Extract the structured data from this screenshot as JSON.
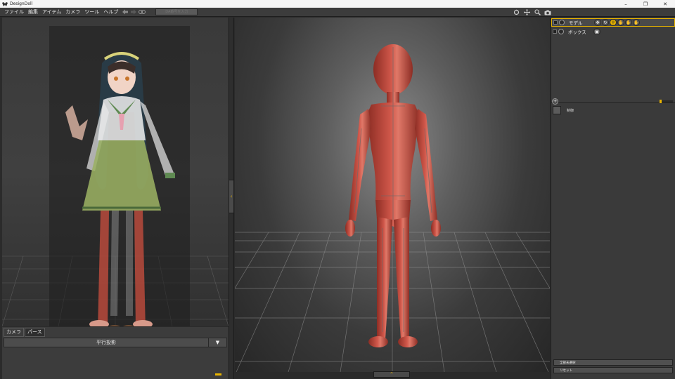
{
  "window": {
    "title": "DesignDoll",
    "minimize": "–",
    "maximize": "❐",
    "close": "✕"
  },
  "menu": {
    "items": [
      "ファイル",
      "編集",
      "アイテム",
      "カメラ",
      "ツール",
      "ヘルプ"
    ],
    "da_input_placeholder": "DA番号を入力"
  },
  "left_panel": {
    "tabs": [
      "カメラ",
      "パース"
    ],
    "active_tab": "パース",
    "projection_value": "平行投影",
    "dropdown_arrow": "▼",
    "collapse_arrow": "‹"
  },
  "viewport": {
    "expand_arrow": "^"
  },
  "scene": {
    "rows": [
      {
        "label": "モデル",
        "selected": true,
        "icons": [
          "move-icon",
          "rotate-icon",
          "zoom-icon",
          "hand-pose-icon",
          "hand-icon",
          "hand-alt-icon"
        ]
      },
      {
        "label": "ボックス",
        "selected": false,
        "icons": [
          "box-icon"
        ]
      }
    ],
    "add_label": "+"
  },
  "properties": {
    "item_label": "制御"
  },
  "buttons": {
    "reset_all": "全部未選択",
    "reset": "リセット"
  },
  "colors": {
    "accent": "#e8b400",
    "doll": "#c0473a"
  }
}
